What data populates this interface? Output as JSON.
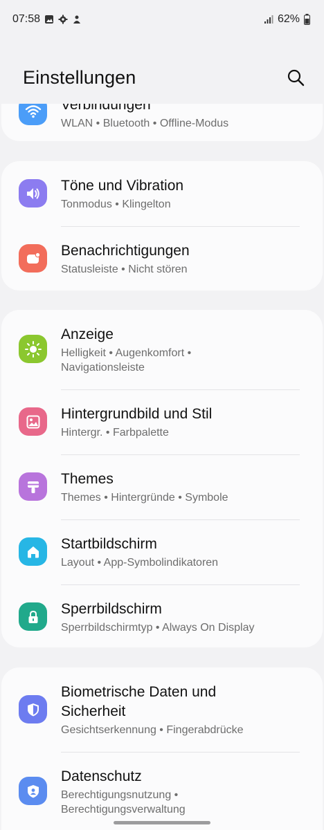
{
  "status": {
    "time": "07:58",
    "battery": "62%"
  },
  "header": {
    "title": "Einstellungen"
  },
  "items": [
    {
      "title": "Verbindungen",
      "sub": "WLAN  •  Bluetooth  •  Offline-Modus",
      "icon": "wifi-icon",
      "color": "#4b9df8"
    },
    {
      "title": "Töne und Vibration",
      "sub": "Tonmodus  •  Klingelton",
      "icon": "speaker-icon",
      "color": "#8c7cf0"
    },
    {
      "title": "Benachrichtigungen",
      "sub": "Statusleiste  •  Nicht stören",
      "icon": "notification-icon",
      "color": "#f26d5b"
    },
    {
      "title": "Anzeige",
      "sub": "Helligkeit  •  Augenkomfort  •",
      "sub2": "Navigationsleiste",
      "icon": "sun-icon",
      "color": "#8bc72f"
    },
    {
      "title": "Hintergrundbild und Stil",
      "sub": "Hintergr.  •  Farbpalette",
      "icon": "picture-icon",
      "color": "#e8688a"
    },
    {
      "title": "Themes",
      "sub": "Themes  •  Hintergründe  •  Symbole",
      "icon": "brush-icon",
      "color": "#b874dc"
    },
    {
      "title": "Startbildschirm",
      "sub": "Layout  •  App-Symbolindikatoren",
      "icon": "home-icon",
      "color": "#27b6e5"
    },
    {
      "title": "Sperrbildschirm",
      "sub": "Sperrbildschirmtyp  •  Always On Display",
      "icon": "lock-icon",
      "color": "#21a98b"
    },
    {
      "title": "Biometrische Daten und",
      "title2": "Sicherheit",
      "sub": "Gesichtserkennung  •  Fingerabdrücke",
      "icon": "shield-icon",
      "color": "#6d7cf0"
    },
    {
      "title": "Datenschutz",
      "sub": "Berechtigungsnutzung  •",
      "sub2": "Berechtigungsverwaltung",
      "icon": "privacy-icon",
      "color": "#5b8cf0"
    }
  ]
}
